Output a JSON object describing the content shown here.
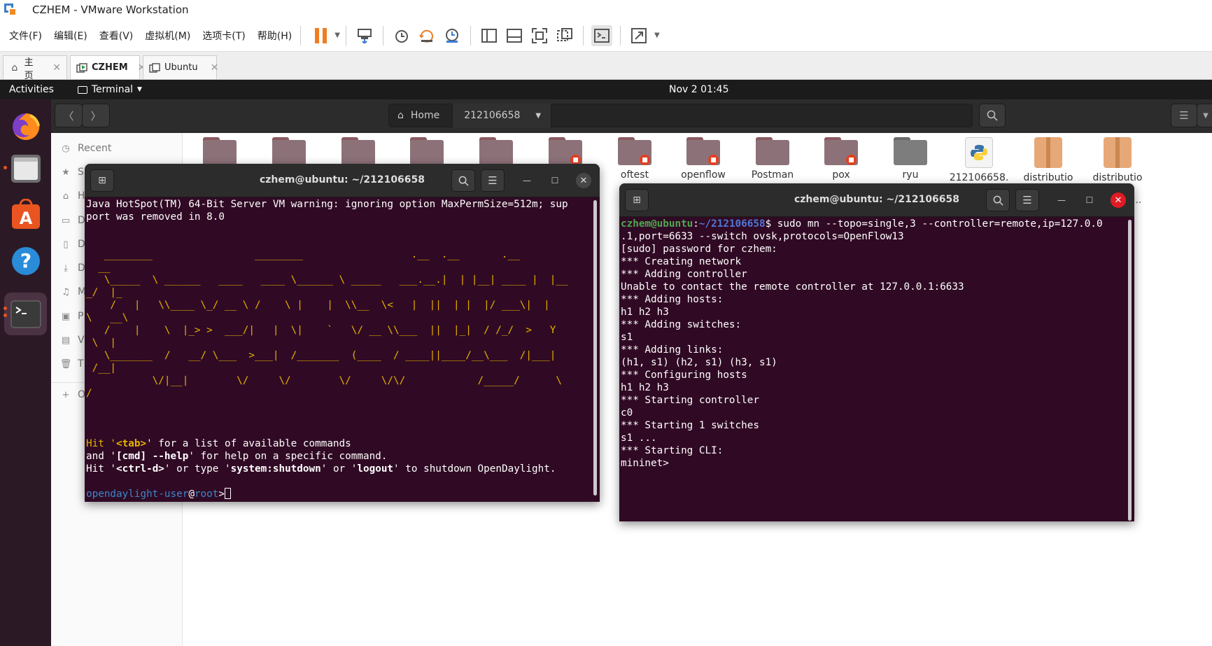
{
  "window": {
    "title": "CZHEM - VMware Workstation"
  },
  "menu": {
    "items": [
      "文件(F)",
      "编辑(E)",
      "查看(V)",
      "虚拟机(M)",
      "选项卡(T)",
      "帮助(H)"
    ]
  },
  "toolbar": {
    "icons": [
      "pause-icon",
      "send-ctrl-alt-del-icon",
      "snapshot-icon",
      "revert-snapshot-icon",
      "manage-snapshots-icon",
      "sidebar-view-icon",
      "thumbnail-view-icon",
      "fullscreen-icon",
      "unity-icon",
      "console-view-icon",
      "stretch-icon"
    ]
  },
  "tabs": [
    {
      "label": "主页",
      "icon": "home-icon",
      "active": false
    },
    {
      "label": "CZHEM",
      "icon": "vm-icon",
      "active": true
    },
    {
      "label": "Ubuntu",
      "icon": "vm-icon",
      "active": false
    }
  ],
  "gnome": {
    "activities": "Activities",
    "app": "Terminal",
    "clock": "Nov 2  01:45"
  },
  "dock": {
    "items": [
      "firefox-icon",
      "files-icon",
      "app-center-icon",
      "help-icon",
      "terminal-icon"
    ],
    "colors": {
      "bg": "#2b1a26",
      "accent": "#e95420"
    }
  },
  "files": {
    "path_home": "Home",
    "path_current": "212106658",
    "sidebar": [
      {
        "label": "Recent",
        "icon": "clock-icon"
      },
      {
        "label": "S",
        "icon": "star-icon"
      },
      {
        "label": "H",
        "icon": "home-icon"
      },
      {
        "label": "D",
        "icon": "desktop-icon"
      },
      {
        "label": "D",
        "icon": "document-icon"
      },
      {
        "label": "D",
        "icon": "download-icon"
      },
      {
        "label": "M",
        "icon": "music-icon"
      },
      {
        "label": "P",
        "icon": "picture-icon"
      },
      {
        "label": "V",
        "icon": "video-icon"
      },
      {
        "label": "T",
        "icon": "trash-icon"
      },
      {
        "label": "O",
        "icon": "plus-icon"
      }
    ],
    "items": [
      {
        "name": "",
        "kind": "folder",
        "locked": false
      },
      {
        "name": "",
        "kind": "folder",
        "locked": false
      },
      {
        "name": "",
        "kind": "folder",
        "locked": false
      },
      {
        "name": "",
        "kind": "folder",
        "locked": false
      },
      {
        "name": "",
        "kind": "folder",
        "locked": false
      },
      {
        "name": "",
        "kind": "folder",
        "locked": true
      },
      {
        "name": "oftest",
        "kind": "folder",
        "locked": true
      },
      {
        "name": "openflow",
        "kind": "folder",
        "locked": true
      },
      {
        "name": "Postman",
        "kind": "folder",
        "locked": false
      },
      {
        "name": "pox",
        "kind": "folder",
        "locked": true
      },
      {
        "name": "ryu",
        "kind": "folder-grey",
        "locked": false
      },
      {
        "name": "212106658.",
        "kind": "python",
        "locked": false
      },
      {
        "name": "distributio",
        "kind": "archive",
        "locked": false
      },
      {
        "name": "distributio",
        "kind": "archive",
        "locked": false
      }
    ],
    "more": "..."
  },
  "term_left": {
    "title": "czhem@ubuntu: ~/212106658",
    "warn": [
      "Java HotSpot(TM) 64-Bit Server VM warning: ignoring option MaxPermSize=512m; sup",
      "port was removed in 8.0"
    ],
    "banner": [
      "",
      "",
      "   ________                 ________                  .__  .__       .__",
      "  __",
      "   \\_____  \\ ______   ____   ____ \\______ \\ _____   ___.__.|  | |__| ____ |  |__",
      "_/  |_",
      "    /   |   \\\\____ \\_/ __ \\ /    \\ |    |  \\\\__  \\<   |  ||  | |  |/ ___\\|  |",
      "\\   __\\",
      "   /    |    \\  |_> >  ___/|   |  \\|    `   \\/ __ \\\\___  ||  |_|  / /_/  >   Y",
      " \\  |",
      "   \\_______  /   __/ \\___  >___|  /_______  (____  / ____||____/__\\___  /|___|",
      " /__|",
      "           \\/|__|        \\/     \\/        \\/     \\/\\/            /_____/      \\",
      "/",
      "",
      "",
      ""
    ],
    "hint_tab_a": "Hit '",
    "hint_tab_b": "<tab>",
    "hint_tab_c": "' for a list of available commands",
    "hint_help_a": "and '",
    "hint_help_b": "[cmd] --help",
    "hint_help_c": "' for help on a specific command.",
    "hint_quit_a": "Hit '",
    "hint_quit_b": "<ctrl-d>",
    "hint_quit_c": "' or type '",
    "hint_quit_d": "system:shutdown",
    "hint_quit_e": "' or '",
    "hint_quit_f": "logout",
    "hint_quit_g": "' to shutdown OpenDaylight.",
    "prompt_user": "opendaylight-user",
    "prompt_at": "@",
    "prompt_host": "root",
    "prompt_end": ">"
  },
  "term_right": {
    "title": "czhem@ubuntu: ~/212106658",
    "prompt_user": "czhem@ubuntu",
    "prompt_colon": ":",
    "prompt_path": "~/212106658",
    "cmd": "$ sudo mn --topo=single,3 --controller=remote,ip=127.0.0",
    "lines": [
      ".1,port=6633 --switch ovsk,protocols=OpenFlow13",
      "[sudo] password for czhem:",
      "*** Creating network",
      "*** Adding controller",
      "Unable to contact the remote controller at 127.0.0.1:6633",
      "*** Adding hosts:",
      "h1 h2 h3",
      "*** Adding switches:",
      "s1",
      "*** Adding links:",
      "(h1, s1) (h2, s1) (h3, s1)",
      "*** Configuring hosts",
      "h1 h2 h3",
      "*** Starting controller",
      "c0",
      "*** Starting 1 switches",
      "s1 ...",
      "*** Starting CLI:",
      "mininet>"
    ]
  },
  "colors": {
    "terminal_bg": "#300a24",
    "banner_yellow": "#e5b100",
    "close_red": "#e01b24"
  }
}
